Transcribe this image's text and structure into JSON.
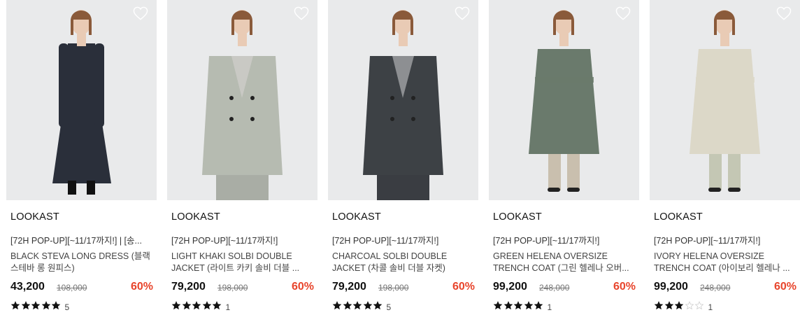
{
  "colors": {
    "discount": "#e8452c",
    "star_filled": "#111111",
    "star_empty": "#cccccc",
    "image_bg": "#e9eaeb"
  },
  "products": [
    {
      "brand": "LOOKAST",
      "promo": "[72H POP-UP][~11/17까지!] | [송...",
      "name": "BLACK STEVA LONG DRESS (블랙 스테바 롱 원피스)",
      "price": "43,200",
      "original_price": "108,000",
      "discount": "60%",
      "rating": 5,
      "review_count": "5",
      "image_icon": "black-long-dress-model",
      "garment_color": "#2a2f3a"
    },
    {
      "brand": "LOOKAST",
      "promo": "[72H POP-UP][~11/17까지!]",
      "name": "LIGHT KHAKI SOLBI DOUBLE JACKET (라이트 카키 솔비 더블 ...",
      "price": "79,200",
      "original_price": "198,000",
      "discount": "60%",
      "rating": 5,
      "review_count": "1",
      "image_icon": "light-khaki-jacket-model",
      "garment_color": "#b6bbb1"
    },
    {
      "brand": "LOOKAST",
      "promo": "[72H POP-UP][~11/17까지!]",
      "name": "CHARCOAL SOLBI DOUBLE JACKET (차콜 솔비 더블 자켓)",
      "price": "79,200",
      "original_price": "198,000",
      "discount": "60%",
      "rating": 5,
      "review_count": "5",
      "image_icon": "charcoal-jacket-model",
      "garment_color": "#3d4145"
    },
    {
      "brand": "LOOKAST",
      "promo": "[72H POP-UP][~11/17까지!]",
      "name": "GREEN HELENA OVERSIZE TRENCH COAT (그린 헬레나 오버...",
      "price": "99,200",
      "original_price": "248,000",
      "discount": "60%",
      "rating": 5,
      "review_count": "1",
      "image_icon": "green-trench-coat-model",
      "garment_color": "#6a7a6c"
    },
    {
      "brand": "LOOKAST",
      "promo": "[72H POP-UP][~11/17까지!]",
      "name": "IVORY HELENA OVERSIZE TRENCH COAT (아이보리 헬레나 ...",
      "price": "99,200",
      "original_price": "248,000",
      "discount": "60%",
      "rating": 3,
      "review_count": "1",
      "image_icon": "ivory-trench-coat-model",
      "garment_color": "#dcd8c8"
    }
  ]
}
